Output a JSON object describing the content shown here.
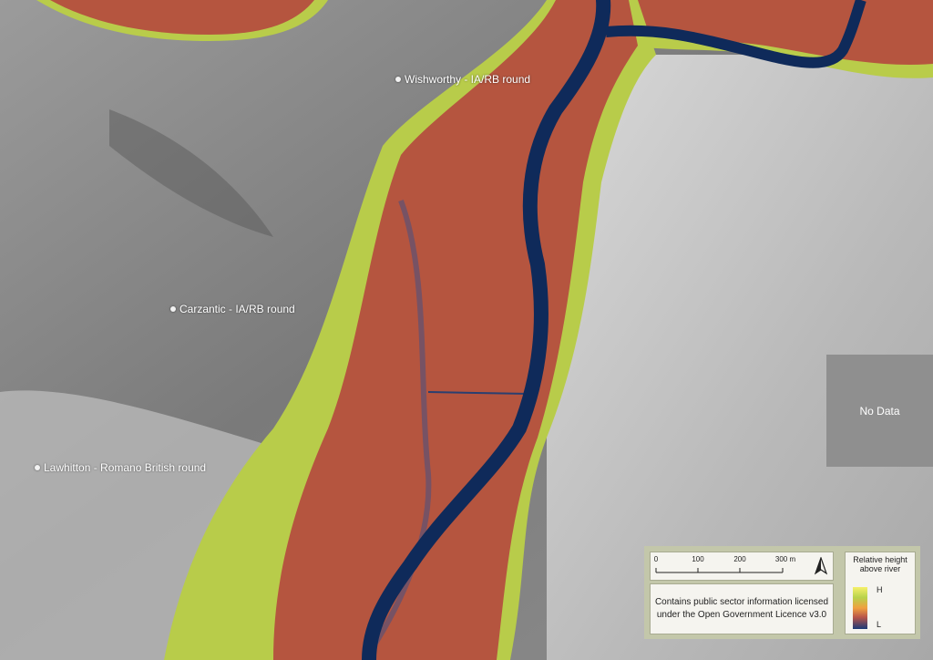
{
  "map": {
    "sites": [
      {
        "label": "Wishworthy - IA/RB round"
      },
      {
        "label": "Carzantic - IA/RB round"
      },
      {
        "label": "Lawhitton - Romano British round"
      }
    ],
    "no_data_label": "No Data",
    "scale_bar": {
      "ticks": [
        "0",
        "100",
        "200",
        "300 m"
      ]
    },
    "credit": {
      "line1": "Contains public sector information licensed",
      "line2": "under the Open Government Licence v3.0"
    },
    "legend": {
      "title_line1": "Relative height",
      "title_line2": "above river",
      "high_label": "H",
      "low_label": "L",
      "colors": {
        "high": "#f6f06a",
        "mid": "#f0a040",
        "low": "#1b3a78"
      }
    },
    "colors": {
      "river": "#0f2a5a",
      "valley": "#b5553f",
      "margin": "#b8cc4a",
      "hillshade": "#9a9a9a"
    }
  }
}
